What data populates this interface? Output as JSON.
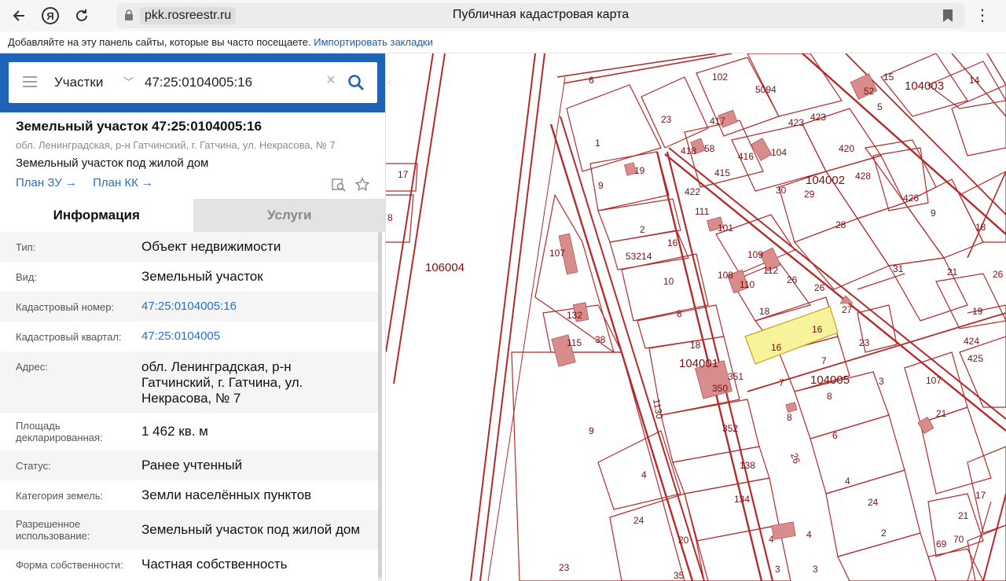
{
  "browser": {
    "url": "pkk.rosreestr.ru",
    "title": "Публичная кадастровая карта",
    "bookmarks_hint": "Добавляйте на эту панель сайты, которые вы часто посещаете.",
    "import_link": "Импортировать закладки"
  },
  "search": {
    "type_label": "Участки",
    "value": "47:25:0104005:16"
  },
  "object": {
    "title": "Земельный участок 47:25:0104005:16",
    "address": "обл. Ленинградская, р-н Гатчинский, г. Гатчина, ул. Некрасова, № 7",
    "use": "Земельный участок под жилой дом",
    "link_plan_zu": "План ЗУ →",
    "link_plan_kk": "План КК →"
  },
  "tabs": {
    "info": "Информация",
    "services": "Услуги"
  },
  "info_rows": [
    {
      "key": "Тип:",
      "value": "Объект недвижимости"
    },
    {
      "key": "Вид:",
      "value": "Земельный участок"
    },
    {
      "key": "Кадастровый номер:",
      "value": "47:25:0104005:16"
    },
    {
      "key": "Кадастровый квартал:",
      "value": "47:25:0104005"
    },
    {
      "key": "Адрес:",
      "value": "обл. Ленинградская, р-н Гатчинский, г. Гатчина, ул. Некрасова, № 7"
    },
    {
      "key": "Площадь декларированная:",
      "value": "1 462 кв. м"
    },
    {
      "key": "Статус:",
      "value": "Ранее учтенный"
    },
    {
      "key": "Категория земель:",
      "value": "Земли населённых пунктов"
    },
    {
      "key": "Разрешенное использование:",
      "value": "Земельный участок под жилой дом"
    },
    {
      "key": "Форма собственности:",
      "value": "Частная собственность"
    }
  ],
  "map": {
    "line_color": "#b52a2a",
    "building_color": "#d98c8c",
    "selected_color": "#f7f39a",
    "quarters": {
      "q1": "106004",
      "q2": "104001",
      "q3": "104005",
      "q4": "104002",
      "q5": "104003"
    },
    "labels": {
      "l1": "6",
      "l2": "102",
      "l3": "5094",
      "l4": "15",
      "l5": "14",
      "l6": "52",
      "l7": "5",
      "l8": "23",
      "l9": "417",
      "l10": "423",
      "l11": "423",
      "l12": "418",
      "l13": "58",
      "l14": "416",
      "l15": "104",
      "l16": "420",
      "l17": "1",
      "l18": "19",
      "l19": "415",
      "l20": "30",
      "l21": "428",
      "l22": "9",
      "l23": "422",
      "l24": "111",
      "l25": "29",
      "l26": "426",
      "l27": "17",
      "l28": "2",
      "l29": "101",
      "l30": "28",
      "l31": "9",
      "l32": "18",
      "l33": "8",
      "l34": "53214",
      "l35": "16",
      "l36": "109",
      "l37": "112",
      "l38": "26",
      "l39": "31",
      "l40": "21",
      "l41": "26",
      "l42": "26",
      "l43": "107",
      "l44": "10",
      "l45": "108",
      "l46": "110",
      "l47": "26",
      "l48": "132",
      "l49": "8",
      "l50": "18",
      "l51": "27",
      "l52": "19",
      "l53": "16",
      "l54": "16",
      "l55": "38",
      "l56": "115",
      "l57": "18",
      "l58": "23",
      "l59": "424",
      "l60": "425",
      "l61": "7",
      "l62": "350",
      "l63": "351",
      "l64": "7",
      "l65": "3",
      "l66": "107",
      "l67": "8",
      "l68": "21",
      "l69": "8",
      "l70": "9",
      "l71": "352",
      "l72": "6",
      "l73": "4",
      "l74": "138",
      "l75": "4",
      "l76": "17",
      "l77": "134",
      "l78": "24",
      "l79": "24",
      "l80": "21",
      "l81": "20",
      "l82": "4",
      "l83": "4",
      "l84": "2",
      "l85": "69",
      "l86": "70",
      "l87": "23",
      "l88": "35",
      "l89": "3",
      "l90": "3",
      "l91": "1130"
    }
  }
}
